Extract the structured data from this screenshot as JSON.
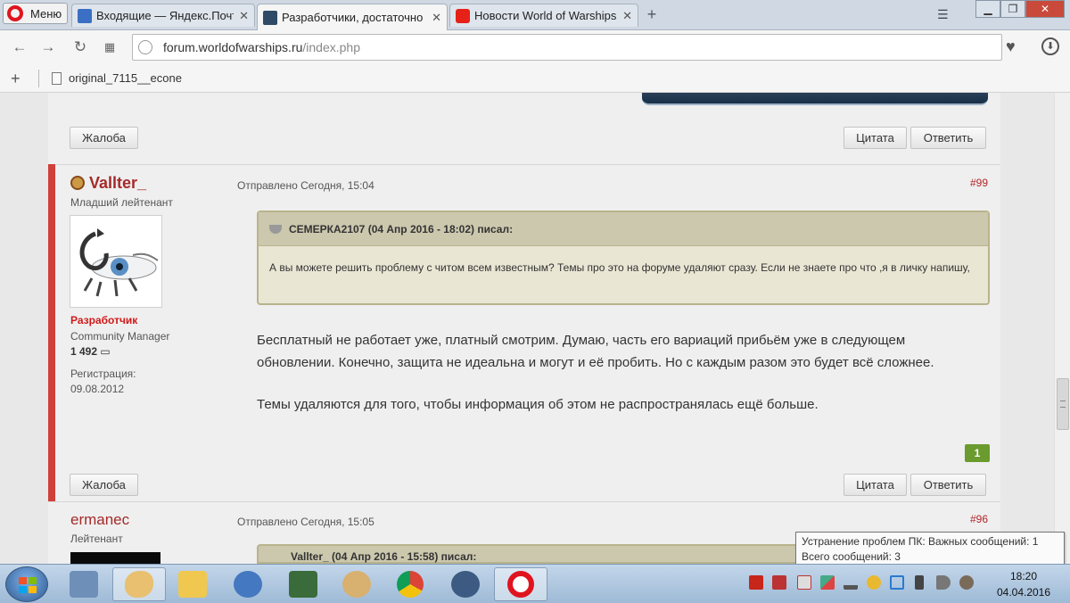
{
  "browser": {
    "menu_label": "Меню",
    "tabs": [
      {
        "title": "Входящие — Яндекс.Почта",
        "active": false
      },
      {
        "title": "Разработчики, достаточно",
        "active": true
      },
      {
        "title": "Новости World of Warships",
        "active": false
      }
    ],
    "url_host": "forum.worldofwarships.ru",
    "url_path": "/index.php",
    "bookmark": "original_7115__econe"
  },
  "forum": {
    "prev_post": {
      "report_label": "Жалоба",
      "quote_label": "Цитата",
      "reply_label": "Ответить"
    },
    "post": {
      "author": "Vallter_",
      "rank": "Младший лейтенант",
      "group": "Разработчик",
      "title": "Community Manager",
      "post_count": "1 492",
      "reg_label": "Регистрация:",
      "reg_date": "09.08.2012",
      "date": "Отправлено Сегодня, 15:04",
      "number": "#99",
      "quote_header": "СЕМЕРКА2107 (04 Апр 2016 - 18:02) писал:",
      "quote_text": "А вы можете решить проблему с читом всем известным?  Темы про это на форуме удаляют сразу. Если не знаете про что ,я в личку напишу,",
      "body_p1": "Бесплатный не работает уже, платный смотрим. Думаю, часть его вариаций прибьём уже в следующем обновлении. Конечно, защита не идеальна и могут и её пробить. Но с каждым разом это будет всё сложнее.",
      "body_p2": "Темы удаляются для того, чтобы информация об этом не распространялась ещё больше.",
      "likes": "1",
      "report_label": "Жалоба",
      "quote_label": "Цитата",
      "reply_label": "Ответить"
    },
    "next_post": {
      "author": "ermanec",
      "rank": "Лейтенант",
      "date": "Отправлено Сегодня, 15:05",
      "number": "#96",
      "quote_header_partial": "Vallter_ (04 Апр 2016 - 15:58) писал:"
    }
  },
  "tooltip": {
    "line1": "Устранение проблем ПК: Важных сообщений: 1",
    "line2": "Всего сообщений: 3"
  },
  "taskbar": {
    "time": "18:20",
    "date": "04.04.2016"
  },
  "colors": {
    "accent_red": "#d0403a",
    "author_color": "#a52a2a",
    "like_green": "#6a9b2f",
    "quote_bg": "#e9e6d4"
  }
}
